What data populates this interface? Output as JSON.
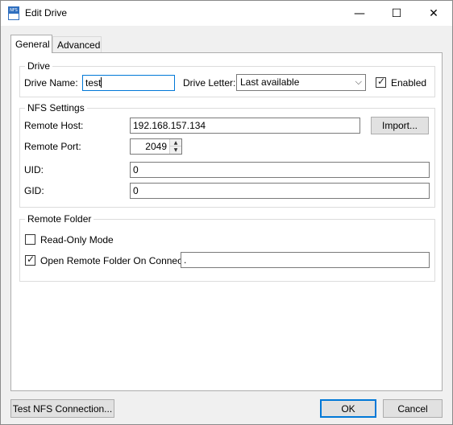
{
  "window": {
    "title": "Edit Drive",
    "icon_text": "NFS",
    "minimize_glyph": "—",
    "maximize_glyph": "☐",
    "close_glyph": "✕"
  },
  "tabs": [
    {
      "label": "General",
      "active": true
    },
    {
      "label": "Advanced",
      "active": false
    }
  ],
  "drive": {
    "legend": "Drive",
    "name_label": "Drive Name:",
    "name_value": "test",
    "letter_label": "Drive Letter:",
    "letter_value": "Last available",
    "enabled_label": "Enabled",
    "enabled_checked": true
  },
  "nfs": {
    "legend": "NFS Settings",
    "host_label": "Remote Host:",
    "host_value": "192.168.157.134",
    "import_label": "Import...",
    "port_label": "Remote Port:",
    "port_value": "2049",
    "uid_label": "UID:",
    "uid_value": "0",
    "gid_label": "GID:",
    "gid_value": "0"
  },
  "remote_folder": {
    "legend": "Remote Folder",
    "readonly_label": "Read-Only Mode",
    "readonly_checked": false,
    "open_label": "Open Remote Folder On Connect:",
    "open_checked": true,
    "open_value": "."
  },
  "footer": {
    "test_label": "Test NFS Connection...",
    "ok_label": "OK",
    "cancel_label": "Cancel"
  },
  "icons": {
    "check": "✓",
    "dropdown": "⌵",
    "spin_up": "▲",
    "spin_down": "▼"
  }
}
